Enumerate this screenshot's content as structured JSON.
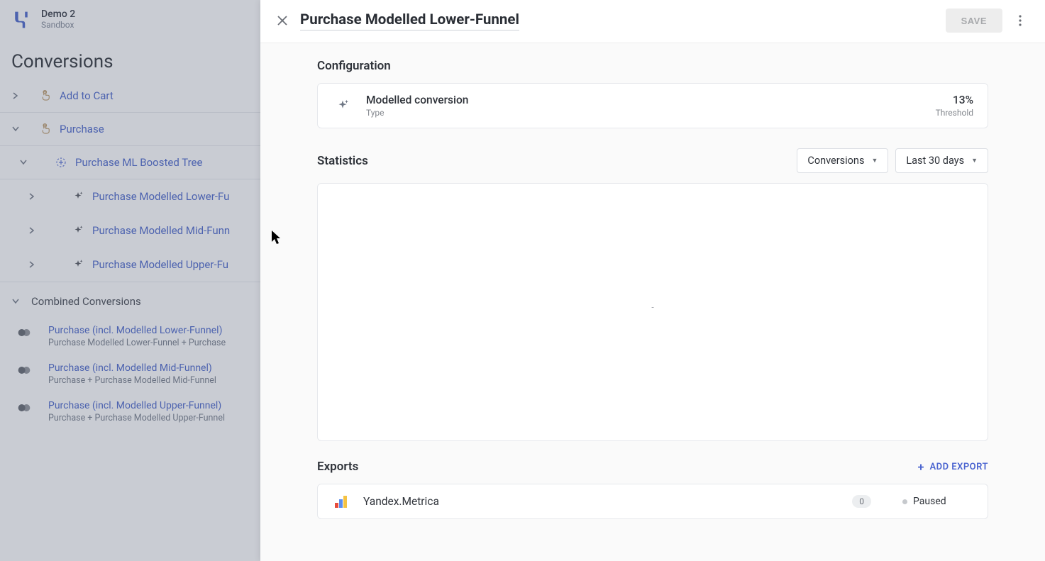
{
  "brand": {
    "title": "Demo 2",
    "subtitle": "Sandbox"
  },
  "page_title": "Conversions",
  "sidebar": {
    "items": [
      {
        "label": "Add to Cart"
      },
      {
        "label": "Purchase"
      }
    ],
    "purchase_children": [
      {
        "label": "Purchase ML Boosted Tree"
      }
    ],
    "modelled_children": [
      {
        "label": "Purchase Modelled Lower-Fu"
      },
      {
        "label": "Purchase Modelled Mid-Funn"
      },
      {
        "label": "Purchase Modelled Upper-Fu"
      }
    ],
    "combined_title": "Combined Conversions",
    "combined": [
      {
        "main": "Purchase (incl. Modelled Lower-Funnel)",
        "sub": "Purchase Modelled Lower-Funnel + Purchase"
      },
      {
        "main": "Purchase (incl. Modelled Mid-Funnel)",
        "sub": "Purchase + Purchase Modelled Mid-Funnel"
      },
      {
        "main": "Purchase (incl. Modelled Upper-Funnel)",
        "sub": "Purchase + Purchase Modelled Upper-Funnel"
      }
    ]
  },
  "panel": {
    "title": "Purchase Modelled Lower-Funnel",
    "save_label": "SAVE",
    "sections": {
      "configuration": "Configuration",
      "statistics": "Statistics",
      "exports": "Exports"
    },
    "config": {
      "type_value": "Modelled conversion",
      "type_label": "Type",
      "threshold_value": "13%",
      "threshold_label": "Threshold"
    },
    "dropdowns": {
      "metric": "Conversions",
      "range": "Last 30 days"
    },
    "chart_empty": "-",
    "add_export": "ADD EXPORT",
    "exports": [
      {
        "name": "Yandex.Metrica",
        "count": "0",
        "status": "Paused"
      }
    ]
  }
}
